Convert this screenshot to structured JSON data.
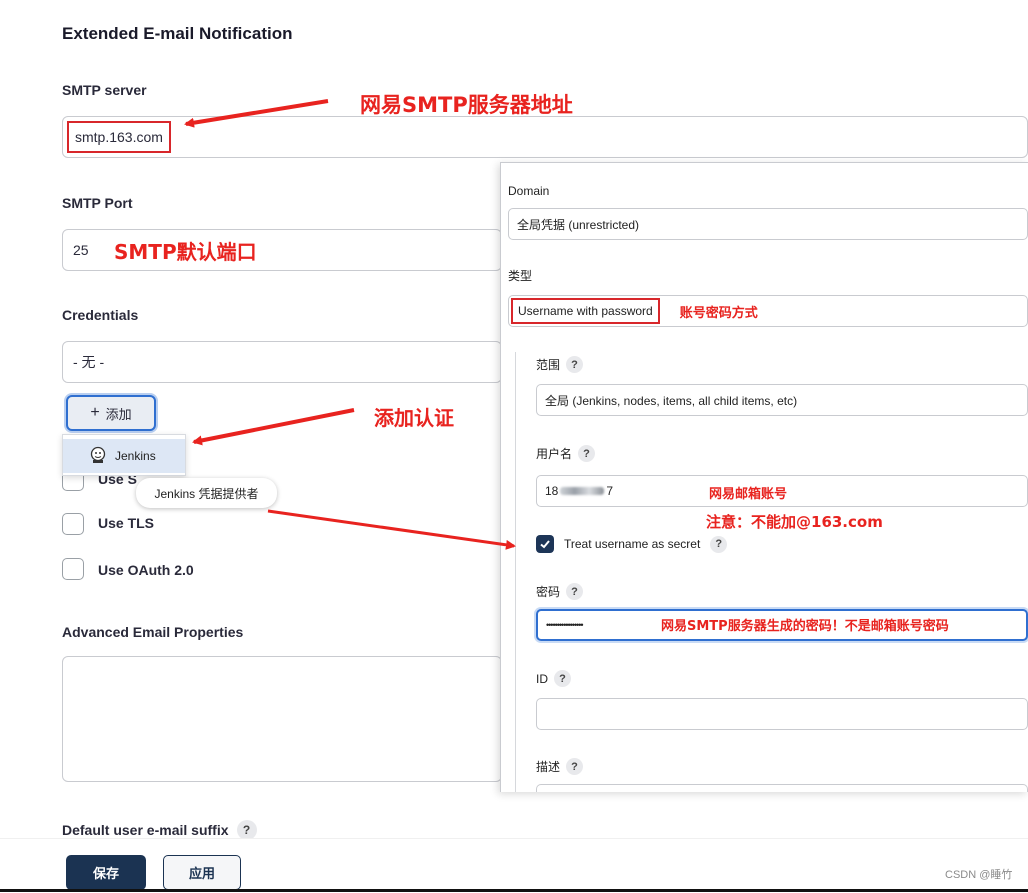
{
  "section_title": "Extended E-mail Notification",
  "smtp_server": {
    "label": "SMTP server",
    "value": "smtp.163.com",
    "annotation": "网易SMTP服务器地址"
  },
  "smtp_port": {
    "label": "SMTP Port",
    "value": "25",
    "annotation": "SMTP默认端口"
  },
  "credentials": {
    "label": "Credentials",
    "value": "- 无 -",
    "add_button": "添加",
    "annotation": "添加认证"
  },
  "dropdown": {
    "item": "Jenkins",
    "tooltip": "Jenkins 凭据提供者"
  },
  "checkboxes": [
    {
      "label": "Use S"
    },
    {
      "label": "Use TLS"
    },
    {
      "label": "Use OAuth 2.0"
    }
  ],
  "advanced": {
    "label": "Advanced Email Properties"
  },
  "default_suffix": {
    "label": "Default user e-mail suffix",
    "help": "?"
  },
  "panel": {
    "domain_label": "Domain",
    "domain_value": "全局凭据 (unrestricted)",
    "type_label": "类型",
    "type_value": "Username with password",
    "type_annotation": "账号密码方式",
    "scope_label": "范围",
    "scope_value": "全局 (Jenkins, nodes, items, all child items, etc)",
    "username_label": "用户名",
    "username_value": "18",
    "username_suffix": "7",
    "username_annotation_1": "网易邮箱账号",
    "username_annotation_2": "注意：不能加@163.com",
    "treat_secret_label": "Treat username as secret",
    "password_label": "密码",
    "password_value": "•••••••••••••••••",
    "password_annotation": "网易SMTP服务器生成的密码！不是邮箱账号密码",
    "id_label": "ID",
    "desc_label": "描述",
    "help": "?"
  },
  "footer": {
    "save": "保存",
    "apply": "应用",
    "watermark": "CSDN @睡竹"
  }
}
